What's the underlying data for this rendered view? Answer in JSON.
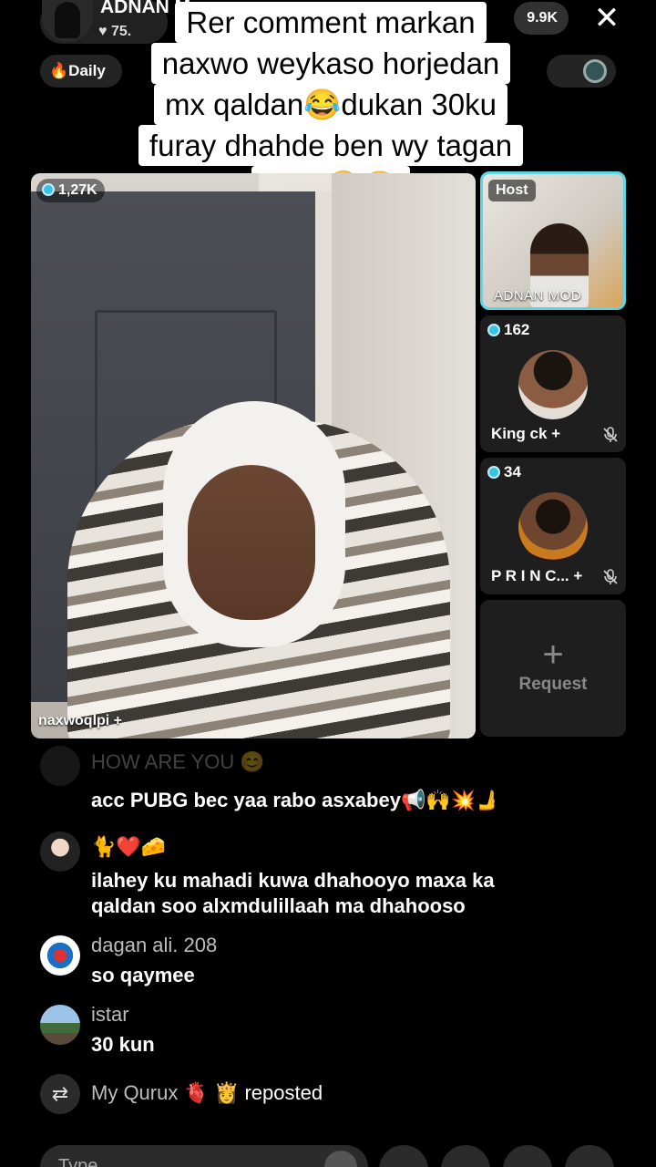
{
  "host": {
    "name": "ADNAN M",
    "likes": "♥ 75.",
    "daily_label": "Daily",
    "viewer_count": "9.9K"
  },
  "caption": {
    "lines": [
      "Rer comment markan",
      "naxwo weykaso horjedan",
      "mx qaldan😂dukan 30ku",
      "furay dhahde ben wy tagan",
      "yihin🤣😂"
    ]
  },
  "main_video": {
    "badge": "1,27K",
    "username": "naxwoqlpi +"
  },
  "side_tiles": {
    "host": {
      "label": "Host",
      "name": "ADNAN MOD"
    },
    "guest1": {
      "count": "162",
      "name": "King ck +"
    },
    "guest2": {
      "count": "34",
      "name": "P R I N C... +"
    },
    "request": {
      "plus": "+",
      "label": "Request"
    }
  },
  "comments": [
    {
      "user": "",
      "text": "HOW ARE YOU 😊"
    },
    {
      "user": "",
      "text": "acc PUBG bec yaa rabo asxabey📢🙌💥🫸"
    },
    {
      "user": "🐈❤️🧀",
      "text": "ilahey ku mahadi kuwa dhahooyo maxa ka",
      "text2": "qaldan soo alxmdulillaah ma dhahooso"
    },
    {
      "user": "dagan  ali. 208",
      "text": "so qaymee"
    },
    {
      "user": "istar",
      "text": "30 kun"
    }
  ],
  "repost": {
    "user": "My Qurux 🫀 👸",
    "action": "reposted"
  },
  "composer": {
    "placeholder": "Type..."
  }
}
